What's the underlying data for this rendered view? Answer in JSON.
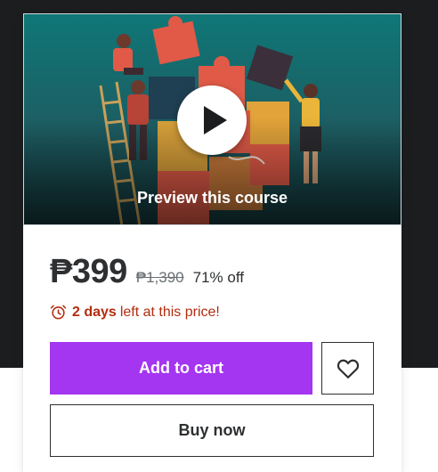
{
  "preview": {
    "label": "Preview this course",
    "play_icon": "play-icon"
  },
  "pricing": {
    "current": "₱399",
    "original": "₱1,390",
    "discount": "71% off"
  },
  "timer": {
    "icon": "alarm-clock-icon",
    "days": "2 days",
    "rest": "left at this price!"
  },
  "actions": {
    "add_to_cart": "Add to cart",
    "wishlist_icon": "heart-icon",
    "buy_now": "Buy now"
  },
  "colors": {
    "page_dark": "#1c1d1f",
    "accent_purple": "#a435f0",
    "timer_red": "#b32d0f",
    "preview_teal": "#0f7777"
  }
}
